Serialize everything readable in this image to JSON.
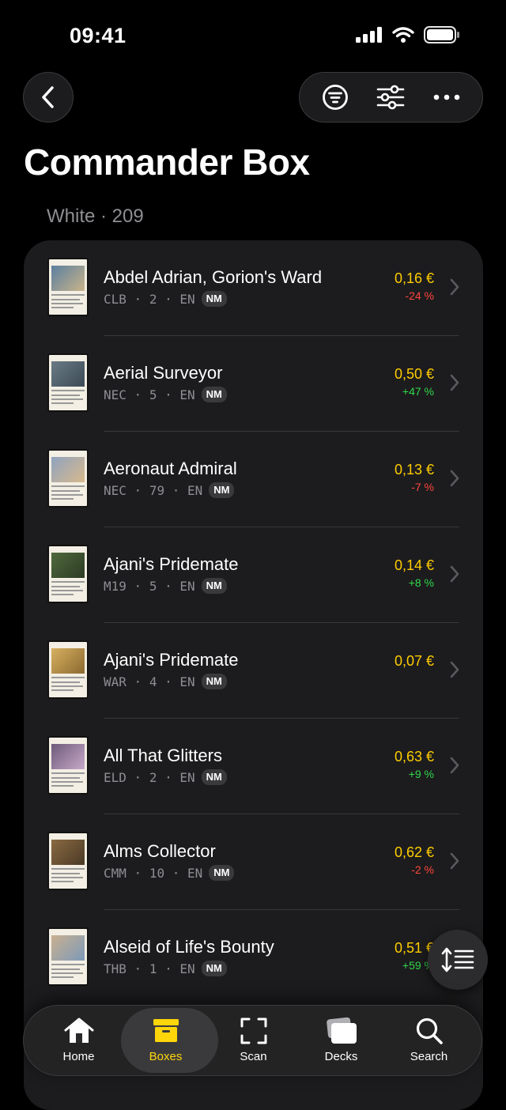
{
  "status": {
    "time": "09:41"
  },
  "title": "Commander Box",
  "section": "White · 209",
  "colors": {
    "price": "#ffcc00",
    "negative": "#ff453a",
    "positive": "#32d74b",
    "active_tab": "#ffd60a"
  },
  "cards": [
    {
      "name": "Abdel Adrian, Gorion's Ward",
      "set": "CLB",
      "qty": "2",
      "lang": "EN",
      "cond": "NM",
      "price": "0,16 €",
      "change": "-24 %",
      "trend": "down"
    },
    {
      "name": "Aerial Surveyor",
      "set": "NEC",
      "qty": "5",
      "lang": "EN",
      "cond": "NM",
      "price": "0,50 €",
      "change": "+47 %",
      "trend": "up"
    },
    {
      "name": "Aeronaut Admiral",
      "set": "NEC",
      "qty": "79",
      "lang": "EN",
      "cond": "NM",
      "price": "0,13 €",
      "change": "-7 %",
      "trend": "down"
    },
    {
      "name": "Ajani's Pridemate",
      "set": "M19",
      "qty": "5",
      "lang": "EN",
      "cond": "NM",
      "price": "0,14 €",
      "change": "+8 %",
      "trend": "up"
    },
    {
      "name": "Ajani's Pridemate",
      "set": "WAR",
      "qty": "4",
      "lang": "EN",
      "cond": "NM",
      "price": "0,07 €",
      "change": "",
      "trend": "none"
    },
    {
      "name": "All That Glitters",
      "set": "ELD",
      "qty": "2",
      "lang": "EN",
      "cond": "NM",
      "price": "0,63 €",
      "change": "+9 %",
      "trend": "up"
    },
    {
      "name": "Alms Collector",
      "set": "CMM",
      "qty": "10",
      "lang": "EN",
      "cond": "NM",
      "price": "0,62 €",
      "change": "-2 %",
      "trend": "down"
    },
    {
      "name": "Alseid of Life's Bounty",
      "set": "THB",
      "qty": "1",
      "lang": "EN",
      "cond": "NM",
      "price": "0,51 €",
      "change": "+59 %",
      "trend": "up"
    }
  ],
  "tabs": [
    {
      "label": "Home",
      "icon": "house-icon"
    },
    {
      "label": "Boxes",
      "icon": "archive-box-icon",
      "active": true
    },
    {
      "label": "Scan",
      "icon": "scan-frame-icon"
    },
    {
      "label": "Decks",
      "icon": "card-stack-icon"
    },
    {
      "label": "Search",
      "icon": "magnifier-icon"
    }
  ]
}
